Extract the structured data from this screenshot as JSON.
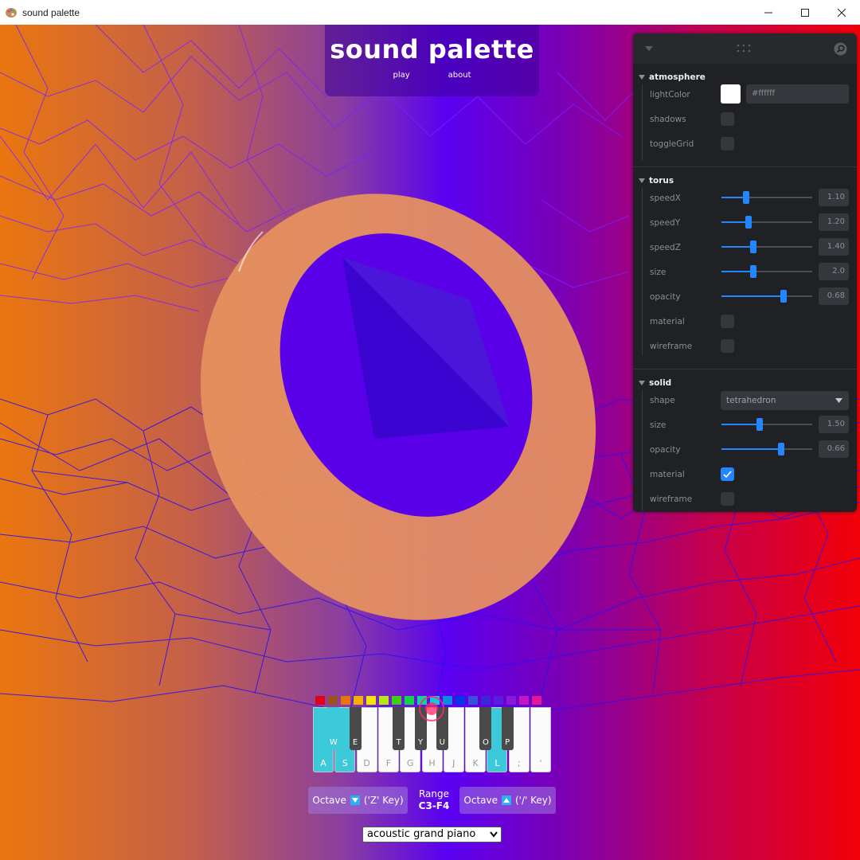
{
  "window": {
    "title": "sound palette"
  },
  "header": {
    "title": "sound palette",
    "nav": [
      "play",
      "about"
    ]
  },
  "panel": {
    "atmosphere": {
      "title": "atmosphere",
      "rows": [
        {
          "label": "lightColor",
          "value": "#ffffff"
        },
        {
          "label": "shadows",
          "checked": false
        },
        {
          "label": "toggleGrid",
          "checked": false
        }
      ]
    },
    "torus": {
      "title": "torus",
      "sliders": [
        {
          "label": "speedX",
          "value": "1.10",
          "fraction": 0.27
        },
        {
          "label": "speedY",
          "value": "1.20",
          "fraction": 0.3
        },
        {
          "label": "speedZ",
          "value": "1.40",
          "fraction": 0.35
        },
        {
          "label": "size",
          "value": "2.0",
          "fraction": 0.35
        },
        {
          "label": "opacity",
          "value": "0.68",
          "fraction": 0.68
        }
      ],
      "material": {
        "label": "material",
        "checked": false
      },
      "wireframe": {
        "label": "wireframe",
        "checked": false
      }
    },
    "solid": {
      "title": "solid",
      "shape": {
        "label": "shape",
        "value": "tetrahedron"
      },
      "sliders": [
        {
          "label": "size",
          "value": "1.50",
          "fraction": 0.42
        },
        {
          "label": "opacity",
          "value": "0.66",
          "fraction": 0.66
        }
      ],
      "material": {
        "label": "material",
        "checked": true
      },
      "wireframe": {
        "label": "wireframe",
        "checked": false
      }
    }
  },
  "swatch_colors": [
    "#e0001b",
    "#a0521d",
    "#e8740c",
    "#f5b000",
    "#f2e600",
    "#b6e614",
    "#3fcf0f",
    "#11d44a",
    "#12d3a0",
    "#13c6d8",
    "#0a8ae0",
    "#0636e6",
    "#3b4fd8",
    "#3a27d6",
    "#5a1ce0",
    "#8a18d8",
    "#c015c8",
    "#e0189a"
  ],
  "keyboard": {
    "white_keys": [
      {
        "label": "A",
        "active": true
      },
      {
        "label": "S",
        "active": true
      },
      {
        "label": "D",
        "active": false
      },
      {
        "label": "F",
        "active": false
      },
      {
        "label": "G",
        "active": false
      },
      {
        "label": "H",
        "active": false
      },
      {
        "label": "J",
        "active": false
      },
      {
        "label": "K",
        "active": false
      },
      {
        "label": "L",
        "active": true
      },
      {
        "label": ";",
        "active": false
      },
      {
        "label": "'",
        "active": false
      }
    ],
    "black_keys": [
      {
        "label": "W",
        "active": true
      },
      {
        "label": "E",
        "active": false
      },
      {
        "label": "T",
        "active": false
      },
      {
        "label": "Y",
        "active": false
      },
      {
        "label": "U",
        "active": false
      },
      {
        "label": "O",
        "active": false
      },
      {
        "label": "P",
        "active": false
      }
    ]
  },
  "octave_down": {
    "label": "Octave",
    "hint": "('Z' Key)"
  },
  "octave_up": {
    "label": "Octave",
    "hint": "('/' Key)"
  },
  "range": {
    "label": "Range",
    "value": "C3-F4"
  },
  "instrument": {
    "selected": "acoustic grand piano"
  }
}
